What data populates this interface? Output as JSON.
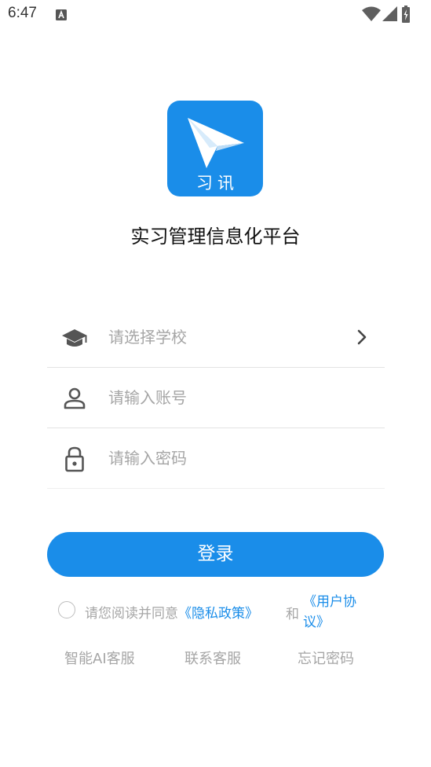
{
  "status_bar": {
    "time": "6:47",
    "notification_icon": "a-notification-icon",
    "icons": [
      "wifi-icon",
      "signal-icon",
      "battery-icon"
    ]
  },
  "app": {
    "icon_label": "习讯",
    "title": "实习管理信息化平台",
    "brand_color": "#1a8de9"
  },
  "form": {
    "school": {
      "placeholder": "请选择学校",
      "icon": "graduation-cap-icon"
    },
    "account": {
      "placeholder": "请输入账号",
      "icon": "person-icon"
    },
    "password": {
      "placeholder": "请输入密码",
      "icon": "lock-icon"
    }
  },
  "login_button": "登录",
  "agreement": {
    "prefix": "请您阅读并同意",
    "privacy_policy": "《隐私政策》",
    "and": "和",
    "user_agreement": "《用户协议》"
  },
  "bottom_links": {
    "ai_service": "智能AI客服",
    "contact_service": "联系客服",
    "forgot_password": "忘记密码"
  }
}
